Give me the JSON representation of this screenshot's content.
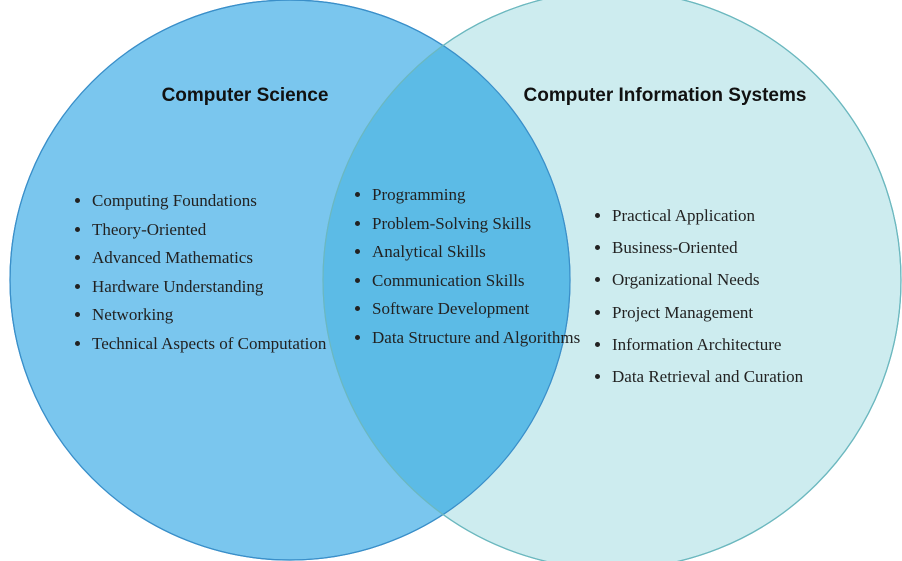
{
  "diagram": {
    "colors": {
      "left_fill": "#5db9ea",
      "left_stroke": "#3a8fc9",
      "right_fill": "#cdecef",
      "right_stroke": "#6cb8bf",
      "overlap_fill": "#5cbbe6"
    },
    "left_set": {
      "title": "Computer Science",
      "items": [
        "Computing Foundations",
        "Theory-Oriented",
        "Advanced Mathematics",
        "Hardware Understanding",
        "Networking",
        "Technical Aspects of Computation"
      ]
    },
    "right_set": {
      "title": "Computer Information Systems",
      "items": [
        "Practical Application",
        "Business-Oriented",
        "Organizational Needs",
        "Project Management",
        "Information Architecture",
        "Data Retrieval and Curation"
      ]
    },
    "overlap": {
      "items": [
        "Programming",
        "Problem-Solving Skills",
        "Analytical Skills",
        "Communication Skills",
        "Software Development",
        "Data Structure and Algorithms"
      ]
    }
  }
}
